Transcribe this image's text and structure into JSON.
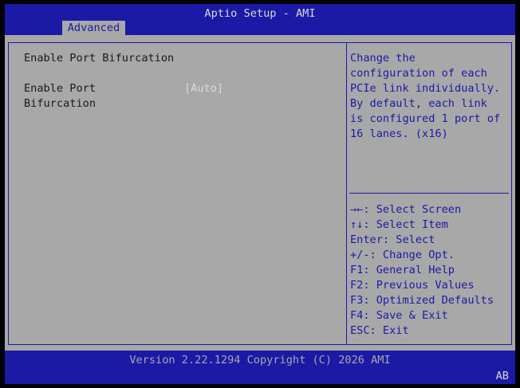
{
  "header": {
    "title": "Aptio Setup - AMI",
    "tabs": [
      {
        "label": "Advanced",
        "active": true
      }
    ]
  },
  "main": {
    "section_title": "Enable Port Bifurcation",
    "options": [
      {
        "label": "Enable Port\nBifurcation",
        "value": "[Auto]"
      }
    ]
  },
  "help": {
    "lines": [
      "Change the",
      "configuration of each",
      "PCIe link individually.",
      "By default, each link",
      "is configured 1 port of",
      "16 lanes. (x16)"
    ],
    "keys": [
      "→←: Select Screen",
      "↑↓: Select Item",
      "Enter: Select",
      "+/-: Change Opt.",
      "F1: General Help",
      "F2: Previous Values",
      "F3: Optimized Defaults",
      "F4: Save & Exit",
      "ESC: Exit"
    ]
  },
  "footer": {
    "version": "Version 2.22.1294 Copyright (C) 2026 AMI",
    "badge": "AB"
  },
  "colors": {
    "frame_blue": "#1a1aa6",
    "panel_gray": "#a8a8a8",
    "highlight_white": "#d8d8d8",
    "text_dark": "#1a1a1a"
  }
}
